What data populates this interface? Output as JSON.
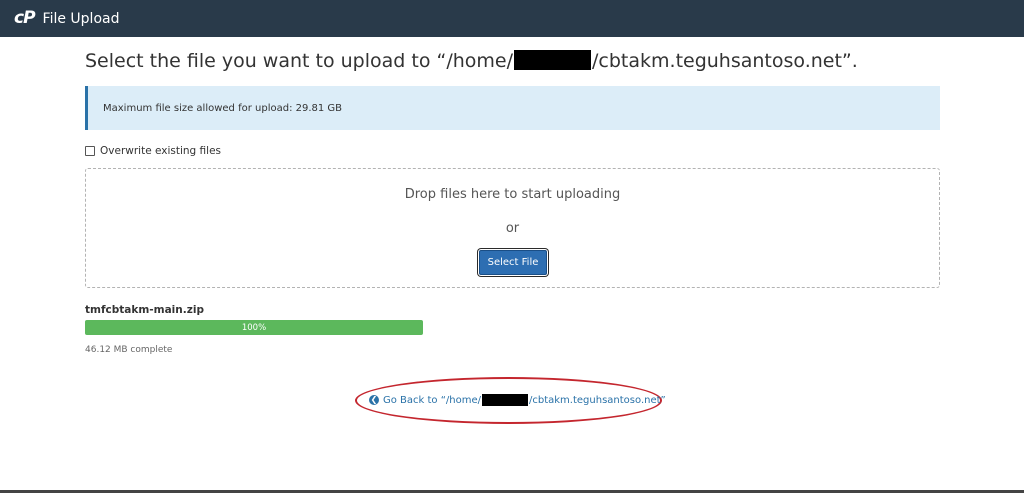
{
  "header": {
    "logo_text": "cP",
    "title": "File Upload"
  },
  "main": {
    "heading_prefix": "Select the file you want to upload to “/home/",
    "heading_suffix": "/cbtakm.teguhsantoso.net”.",
    "max_size_notice": "Maximum file size allowed for upload: 29.81 GB",
    "overwrite_label": "Overwrite existing files",
    "overwrite_checked": false
  },
  "dropzone": {
    "drop_text": "Drop files here to start uploading",
    "or_text": "or",
    "select_button_label": "Select File"
  },
  "upload": {
    "file_name": "tmfcbtakm-main.zip",
    "progress_label": "100%",
    "progress_fraction": 1.0,
    "status_text": "46.12 MB complete"
  },
  "footer": {
    "go_back_prefix": "Go Back to “/home/",
    "go_back_suffix": "/cbtakm.teguhsantoso.net”",
    "go_back_icon": "arrow-circle-left-icon"
  },
  "colors": {
    "topbar": "#293a4a",
    "alert_bg": "#dcedf8",
    "alert_border": "#2a72a8",
    "button": "#2d6eb2",
    "progress": "#5cb85c",
    "link": "#2a72a8",
    "annotation_oval": "#c4262e"
  }
}
